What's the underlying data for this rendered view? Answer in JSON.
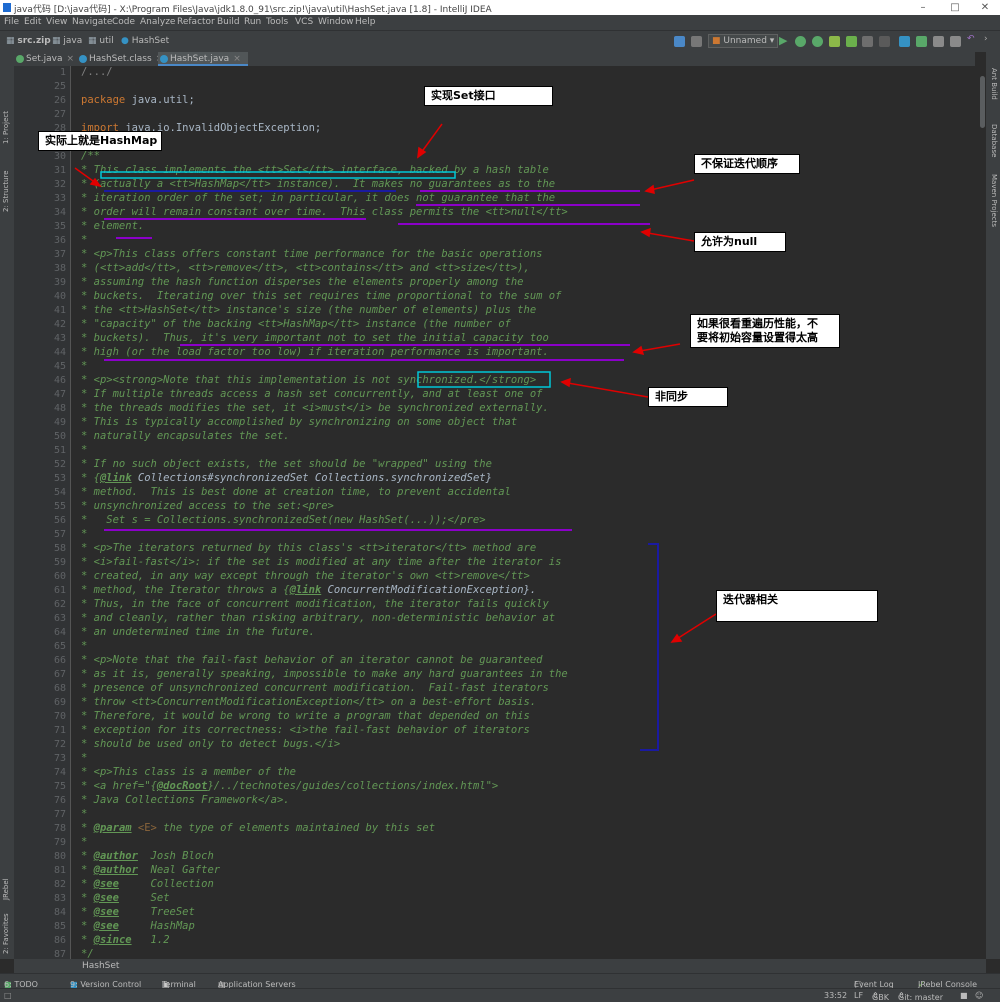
{
  "window": {
    "title": "java代码 [D:\\java代码] - X:\\Program Files\\Java\\jdk1.8.0_91\\src.zip!\\java\\util\\HashSet.java [1.8] - IntelliJ IDEA"
  },
  "menu": [
    "File",
    "Edit",
    "View",
    "Navigate",
    "Code",
    "Analyze",
    "Refactor",
    "Build",
    "Run",
    "Tools",
    "VCS",
    "Window",
    "Help"
  ],
  "breadcrumbs": [
    "src.zip",
    "java",
    "util",
    "HashSet"
  ],
  "run_config": "Unnamed",
  "tabs": [
    {
      "label": "Set.java",
      "active": false
    },
    {
      "label": "HashSet.class",
      "active": false
    },
    {
      "label": "HashSet.java",
      "active": true
    }
  ],
  "left_tools": [
    "1: Project",
    "2: Structure",
    "JRebel",
    "2: Favorites"
  ],
  "right_tools": [
    "Ant Build",
    "Database",
    "Maven Projects"
  ],
  "code": {
    "line_numbers": [
      "1",
      "25",
      "26",
      "27",
      "28",
      "29",
      "30",
      "31",
      "32",
      "33",
      "34",
      "35",
      "36",
      "37",
      "38",
      "39",
      "40",
      "41",
      "42",
      "43",
      "44",
      "45",
      "46",
      "47",
      "48",
      "49",
      "50",
      "51",
      "52",
      "53",
      "54",
      "55",
      "56",
      "57",
      "58",
      "59",
      "60",
      "61",
      "62",
      "63",
      "64",
      "65",
      "66",
      "67",
      "68",
      "69",
      "70",
      "71",
      "72",
      "73",
      "74",
      "75",
      "76",
      "77",
      "78",
      "79",
      "80",
      "81",
      "82",
      "83",
      "84",
      "85",
      "86",
      "87"
    ],
    "fold": "/.../",
    "pkg_kw": "package",
    "pkg_name": " java.util;",
    "import_kw": "import",
    "import_name": " java.io.InvalidObjectException;",
    "open": "/**",
    "l31a": "* ",
    "l31b": "This class implements the <tt>Set</tt> interface",
    "l31c": ", backed by a hash table",
    "l32": "* (actually a <tt>HashMap</tt> instance).  It makes no guarantees as to the",
    "l33": "* iteration order of the set; in particular, it does not guarantee that the",
    "l34": "* order will remain constant over time.  This class permits the <tt>null</tt>",
    "l35": "* element.",
    "l36": "*",
    "l37": "* <p>This class offers constant time performance for the basic operations",
    "l38": "* (<tt>add</tt>, <tt>remove</tt>, <tt>contains</tt> and <tt>size</tt>),",
    "l39": "* assuming the hash function disperses the elements properly among the",
    "l40": "* buckets.  Iterating over this set requires time proportional to the sum of",
    "l41": "* the <tt>HashSet</tt> instance's size (the number of elements) plus the",
    "l42": "* \"capacity\" of the backing <tt>HashMap</tt> instance (the number of",
    "l43": "* buckets).  Thus, it's very important not to set the initial capacity too",
    "l44": "* high (or the load factor too low) if iteration performance is important.",
    "l45": "*",
    "l46": "* <p><strong>Note that this implementation is not synchronized.</strong>",
    "l47": "* If multiple threads access a hash set concurrently, and at least one of",
    "l48": "* the threads modifies the set, it <i>must</i> be synchronized externally.",
    "l49": "* This is typically accomplished by synchronizing on some object that",
    "l50": "* naturally encapsulates the set.",
    "l51": "*",
    "l52": "* If no such object exists, the set should be \"wrapped\" using the",
    "l53a": "* {",
    "l53b": "@link",
    "l53c": " Collections#synchronizedSet Collections.synchronizedSet}",
    "l54": "* method.  This is best done at creation time, to prevent accidental",
    "l55": "* unsynchronized access to the set:<pre>",
    "l56": "*   Set s = Collections.synchronizedSet(new HashSet(...));</pre>",
    "l57": "*",
    "l58": "* <p>The iterators returned by this class's <tt>iterator</tt> method are",
    "l59": "* <i>fail-fast</i>: if the set is modified at any time after the iterator is",
    "l60": "* created, in any way except through the iterator's own <tt>remove</tt>",
    "l61a": "* method, the Iterator throws a {",
    "l61b": "@link",
    "l61c": " ConcurrentModificationException}.",
    "l62": "* Thus, in the face of concurrent modification, the iterator fails quickly",
    "l63": "* and cleanly, rather than risking arbitrary, non-deterministic behavior at",
    "l64": "* an undetermined time in the future.",
    "l65": "*",
    "l66": "* <p>Note that the fail-fast behavior of an iterator cannot be guaranteed",
    "l67": "* as it is, generally speaking, impossible to make any hard guarantees in the",
    "l68": "* presence of unsynchronized concurrent modification.  Fail-fast iterators",
    "l69": "* throw <tt>ConcurrentModificationException</tt> on a best-effort basis.",
    "l70": "* Therefore, it would be wrong to write a program that depended on this",
    "l71": "* exception for its correctness: <i>the fail-fast behavior of iterators",
    "l72": "* should be used only to detect bugs.</i>",
    "l73": "*",
    "l74": "* <p>This class is a member of the",
    "l75a": "* <a href=\"{",
    "l75b": "@docRoot",
    "l75c": "}/../technotes/guides/collections/index.html\">",
    "l76": "* Java Collections Framework</a>.",
    "l77": "*",
    "l78a": "* ",
    "l78b": "@param",
    "l78c": " <E>",
    "l78d": " the type of elements maintained by this set",
    "l79": "*",
    "l80a": "* ",
    "l80b": "@author",
    "l80c": "  Josh Bloch",
    "l81a": "* ",
    "l81b": "@author",
    "l81c": "  Neal Gafter",
    "l82a": "* ",
    "l82b": "@see",
    "l82c": "     Collection",
    "l83a": "* ",
    "l83b": "@see",
    "l83c": "     Set",
    "l84a": "* ",
    "l84b": "@see",
    "l84c": "     TreeSet",
    "l85a": "* ",
    "l85b": "@see",
    "l85c": "     HashMap",
    "l86a": "* ",
    "l86b": "@since",
    "l86c": "   1.2",
    "l87": "*/"
  },
  "annotations": {
    "set_interface": "实现Set接口",
    "hashmap": "实际上就是HashMap",
    "no_order": "不保证迭代顺序",
    "allow_null": "允许为null",
    "capacity_1": "如果很看重遍历性能，不",
    "capacity_2": "要将初始容量设置得太高",
    "not_sync": "非同步",
    "iterator": "迭代器相关"
  },
  "bottom_breadcrumb": "HashSet",
  "bottom_tools": [
    "6: TODO",
    "9: Version Control",
    "Terminal",
    "Application Servers"
  ],
  "bottom_right_tools": [
    "Event Log",
    "JRebel Console"
  ],
  "status": {
    "position": "33:52",
    "line_sep": "LF",
    "encoding": "GBK",
    "git": "Git: master"
  },
  "colors": {
    "accent_annotation_cyan": "#00c8d8",
    "accent_annotation_purple": "#8b00c9",
    "accent_annotation_red": "#e00000",
    "accent_annotation_navy": "#1a1aa0"
  }
}
